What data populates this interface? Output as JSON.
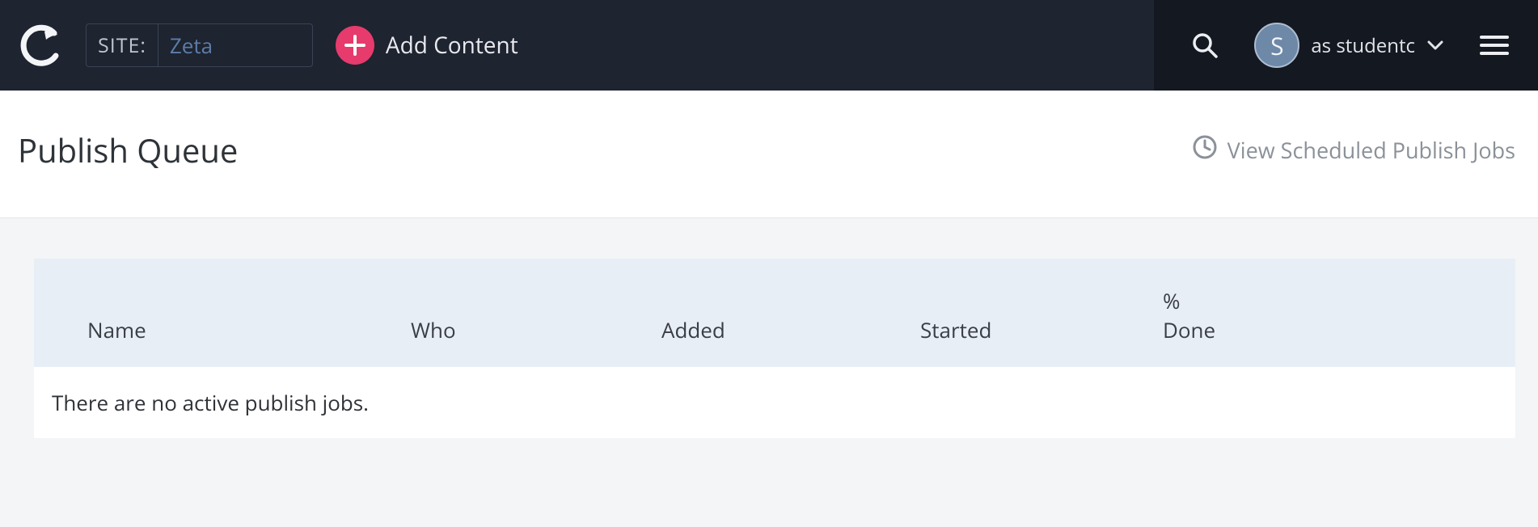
{
  "header": {
    "site_label": "SITE:",
    "site_value": "Zeta",
    "add_content_label": "Add Content",
    "user": {
      "avatar_initial": "S",
      "as_label": "as studentc"
    }
  },
  "page": {
    "title": "Publish Queue",
    "scheduled_link": "View Scheduled Publish Jobs"
  },
  "table": {
    "columns": {
      "name": "Name",
      "who": "Who",
      "added": "Added",
      "started": "Started",
      "done": "% Done"
    },
    "empty_message": "There are no active publish jobs."
  }
}
